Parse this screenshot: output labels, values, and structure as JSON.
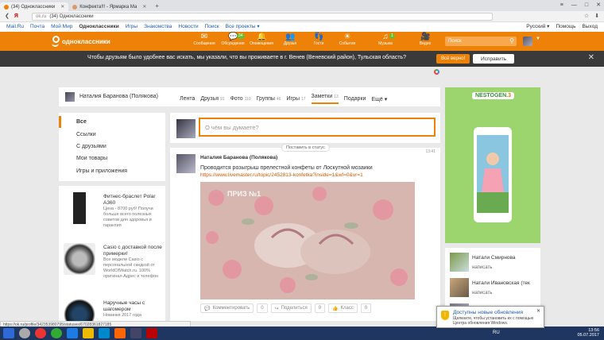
{
  "browser": {
    "tabs": [
      {
        "label": "(34) Одноклассники",
        "active": true
      },
      {
        "label": "Конфекта!!! - Ярмарка Ма",
        "active": false
      }
    ],
    "url_domain": "ok.ru",
    "url_title": "(34) Одноклассники",
    "window_controls": [
      "≡",
      "—",
      "□",
      "✕"
    ]
  },
  "portal": {
    "links": [
      "Mail.Ru",
      "Почта",
      "Мой Мир",
      "Одноклассники",
      "Игры",
      "Знакомства",
      "Новости",
      "Поиск",
      "Все проекты ▾"
    ],
    "right": [
      "Русский ▾",
      "Помощь",
      "Выход"
    ]
  },
  "toolbar": {
    "logo_text": "одноклассники",
    "items": [
      {
        "label": "Сообщения",
        "icon": "envelope-icon",
        "badge": ""
      },
      {
        "label": "Обсуждения",
        "icon": "chat-icon",
        "badge": "34"
      },
      {
        "label": "Оповещения",
        "icon": "bell-icon",
        "badge": ""
      },
      {
        "label": "Друзья",
        "icon": "friends-icon",
        "badge": ""
      },
      {
        "label": "Гости",
        "icon": "footprints-icon",
        "badge": ""
      },
      {
        "label": "События",
        "icon": "events-icon",
        "badge": ""
      },
      {
        "label": "Музыка",
        "icon": "music-icon",
        "badge": "1"
      },
      {
        "label": "Видео",
        "icon": "video-icon",
        "badge": ""
      }
    ],
    "search_placeholder": "Поиск"
  },
  "notice": {
    "text": "Чтобы друзьям было удобнее вас искать, мы указали, что вы проживаете в г. Венев (Веневский район), Тульская область?",
    "confirm": "Всё верно!",
    "fix": "Исправить"
  },
  "profile": {
    "name": "Наталия Баранова (Полякова)",
    "tabs": [
      {
        "label": "Лента",
        "count": ""
      },
      {
        "label": "Друзья",
        "count": "91"
      },
      {
        "label": "Фото",
        "count": "110"
      },
      {
        "label": "Группы",
        "count": "46"
      },
      {
        "label": "Игры",
        "count": "17"
      },
      {
        "label": "Заметки",
        "count": "13"
      },
      {
        "label": "Подарки",
        "count": ""
      },
      {
        "label": "Ещё ▾",
        "count": ""
      }
    ]
  },
  "leftmenu": [
    "Все",
    "Ссылки",
    "С друзьями",
    "Мои товары",
    "Игры и приложения"
  ],
  "ads": [
    {
      "title": "Фитнес-браслет Polar A360",
      "sub": "Цена - 8700 руб! Получи больше всего полезных советов для здоровья и гарантия"
    },
    {
      "title": "Casio с доставкой после примерки!",
      "sub": "Все модели Casio с персональной скидкой от WorldOfWatch.ru. 100% оригинал Адрес и телефон"
    },
    {
      "title": "Наручные часы с шагомером",
      "sub": "Новинки 2017 года"
    }
  ],
  "composer": {
    "placeholder": "О чём вы думаете?"
  },
  "post": {
    "status_btn": "Поставить в статус",
    "time": "13:41",
    "author": "Наталия Баранова (Полякова)",
    "text": "Проводится розыгрыш прелестной конфеты от Лоскутной мозаики",
    "link": "https://www.livemaster.ru/topic/2452813-konfetka?inside=1&wf=0&vr=1",
    "image_caption": "ПРИЗ №1",
    "actions": [
      {
        "label": "Комментировать",
        "count": "0"
      },
      {
        "label": "Поделиться",
        "count": "0"
      },
      {
        "label": "Класс",
        "count": "0"
      }
    ]
  },
  "banner": {
    "brand": "NESTOGEN",
    "num": "3"
  },
  "friends": [
    {
      "name": "Натали Смирнова",
      "action": "написать"
    },
    {
      "name": "Натали Ивановская (тек",
      "action": "написать"
    },
    {
      "name": "",
      "action": ""
    }
  ],
  "statusbar_url": "https://ok.ru/profile/342353980795/statuses/67028361827185",
  "winpop": {
    "title": "Доступны новые обновления",
    "text": "Щелкните, чтобы установить их с помощью Центра обновления Windows."
  },
  "tray": {
    "lang": "RU",
    "time": "13:56",
    "date": "05.07.2017"
  }
}
